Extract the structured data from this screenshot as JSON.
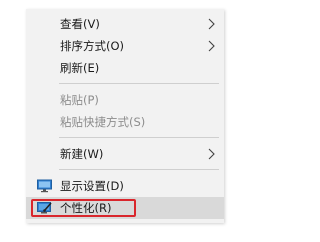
{
  "menu": {
    "items": [
      {
        "label": "查看(V)",
        "has_submenu": true,
        "enabled": true
      },
      {
        "label": "排序方式(O)",
        "has_submenu": true,
        "enabled": true
      },
      {
        "label": "刷新(E)",
        "has_submenu": false,
        "enabled": true
      },
      {
        "label": "粘贴(P)",
        "has_submenu": false,
        "enabled": false
      },
      {
        "label": "粘贴快捷方式(S)",
        "has_submenu": false,
        "enabled": false
      },
      {
        "label": "新建(W)",
        "has_submenu": true,
        "enabled": true
      },
      {
        "label": "显示设置(D)",
        "has_submenu": false,
        "enabled": true,
        "icon": "display-settings-icon"
      },
      {
        "label": "个性化(R)",
        "has_submenu": false,
        "enabled": true,
        "icon": "personalize-icon",
        "highlighted": true
      }
    ]
  },
  "colors": {
    "menu_bg": "#f2f2f2",
    "hover_bg": "#d9d9d9",
    "highlight_border": "#d9262c",
    "disabled_text": "#8d8d8d"
  }
}
